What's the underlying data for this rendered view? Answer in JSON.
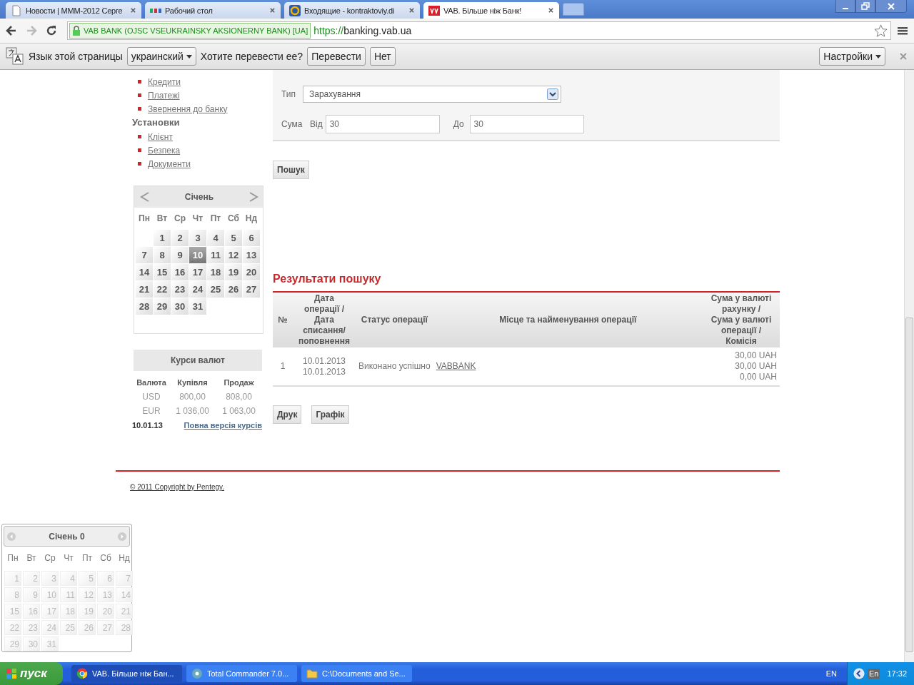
{
  "browser": {
    "tabs": [
      {
        "title": "Новости | МММ-2012 Серге",
        "selected": false
      },
      {
        "title": "Рабочий стол",
        "selected": false
      },
      {
        "title": "Входящие - kontraktoviy.di",
        "selected": false
      },
      {
        "title": "VAB. Більше ніж Банк!",
        "selected": true
      }
    ],
    "identity": "VAB BANK (OJSC VSEUKRAINSKY AKSIONERNY BANK) [UA]",
    "url_scheme": "https://",
    "url_host": "banking.vab.ua"
  },
  "translate_bar": {
    "label": "Язык этой страницы",
    "language": "украинский",
    "question": "Хотите перевести ее?",
    "buttons": [
      "Перевести",
      "Нет"
    ],
    "settings": "Настройки"
  },
  "sidebar": {
    "groups": [
      {
        "items": [
          "Кредити",
          "Платежі",
          "Звернення до банку"
        ]
      },
      {
        "title": "Установки",
        "items": [
          "Клієнт",
          "Безпека",
          "Документи"
        ]
      }
    ]
  },
  "calendar": {
    "month": "Січень",
    "weekdays": [
      "Пн",
      "Вт",
      "Ср",
      "Чт",
      "Пт",
      "Сб",
      "Нд"
    ],
    "weeks": [
      [
        {
          "day": "1",
          "selected": false
        },
        {
          "day": "2",
          "selected": false
        },
        {
          "day": "3",
          "selected": false
        },
        {
          "day": "4",
          "selected": false
        },
        {
          "day": "5",
          "selected": false
        },
        {
          "day": "6",
          "selected": false
        }
      ],
      [
        {
          "day": "7",
          "selected": false
        },
        {
          "day": "8",
          "selected": false
        },
        {
          "day": "9",
          "selected": false
        },
        {
          "day": "10",
          "selected": true
        },
        {
          "day": "11",
          "selected": false
        },
        {
          "day": "12",
          "selected": false
        },
        {
          "day": "13",
          "selected": false
        }
      ],
      [
        {
          "day": "14",
          "selected": false
        },
        {
          "day": "15",
          "selected": false
        },
        {
          "day": "16",
          "selected": false
        },
        {
          "day": "17",
          "selected": false
        },
        {
          "day": "18",
          "selected": false
        },
        {
          "day": "19",
          "selected": false
        },
        {
          "day": "20",
          "selected": false
        }
      ],
      [
        {
          "day": "21",
          "selected": false
        },
        {
          "day": "22",
          "selected": false
        },
        {
          "day": "23",
          "selected": false
        },
        {
          "day": "24",
          "selected": false
        },
        {
          "day": "25",
          "selected": false
        },
        {
          "day": "26",
          "selected": false
        },
        {
          "day": "27",
          "selected": false
        }
      ],
      [
        {
          "day": "28",
          "selected": false
        },
        {
          "day": "29",
          "selected": false
        },
        {
          "day": "30",
          "selected": false
        },
        {
          "day": "31",
          "selected": false
        }
      ]
    ]
  },
  "rates": {
    "title": "Курси валют",
    "columns": [
      "Валюта",
      "Купівля",
      "Продаж"
    ],
    "rows": [
      [
        "USD",
        "800,00",
        "808,00"
      ],
      [
        "EUR",
        "1 036,00",
        "1 063,00"
      ]
    ],
    "date": "10.01.13",
    "link": "Повна версія курсів"
  },
  "filter": {
    "type_label": "Тип",
    "type_value": "Зарахування",
    "sum_label": "Сума",
    "from_label": "Від",
    "from_value": "30",
    "to_label": "До",
    "to_value": "30",
    "search_button": "Пошук"
  },
  "results": {
    "title": "Результати пошуку",
    "columns": [
      "№",
      "Дата\nоперації /\nДата\nсписання/\nпоповнення",
      "Статус операції",
      "Місце та найменування операції",
      "Сума у валюті\nрахунку /\nСума у валюті\nоперації /\nКомісія"
    ],
    "rows": [
      {
        "number": "1",
        "dates": [
          "10.01.2013",
          "10.01.2013"
        ],
        "status": "Виконано успішно",
        "place": "VABBANK",
        "amounts": [
          "30,00 UAH",
          "30,00 UAH",
          "0,00 UAH"
        ]
      }
    ],
    "buttons": [
      "Друк",
      "Графік"
    ]
  },
  "footer": {
    "copyright": "© 2011 Copyright by Pentegy."
  },
  "popup_calendar": {
    "month": "Січень 0",
    "weekdays": [
      "Пн",
      "Вт",
      "Ср",
      "Чт",
      "Пт",
      "Сб",
      "Нд"
    ],
    "weeks": [
      [
        "1",
        "2",
        "3",
        "4",
        "5",
        "6",
        "7"
      ],
      [
        "8",
        "9",
        "10",
        "11",
        "12",
        "13",
        "14"
      ],
      [
        "15",
        "16",
        "17",
        "18",
        "19",
        "20",
        "21"
      ],
      [
        "22",
        "23",
        "24",
        "25",
        "26",
        "27",
        "28"
      ],
      [
        "29",
        "30",
        "31"
      ]
    ]
  },
  "taskbar": {
    "start": "пуск",
    "tasks": [
      {
        "title": "VAB. Більше ніж Бан...",
        "selected": true
      },
      {
        "title": "Total Commander 7.0...",
        "selected": false
      },
      {
        "title": "C:\\Documents and Se...",
        "selected": false
      }
    ],
    "language": "EN",
    "input_language": "En",
    "time": "17:32"
  }
}
